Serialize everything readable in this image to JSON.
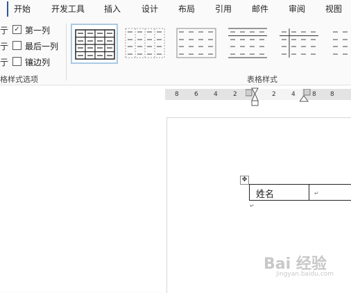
{
  "tabs": [
    "开始",
    "开发工具",
    "插入",
    "设计",
    "布局",
    "引用",
    "邮件",
    "审阅",
    "视图"
  ],
  "style_options": {
    "items": [
      {
        "cut_text": "亍",
        "label": "第一列",
        "checked": true
      },
      {
        "cut_text": "亍",
        "label": "最后一列",
        "checked": false
      },
      {
        "cut_text": "亍",
        "label": "镶边列",
        "checked": false
      }
    ],
    "group_label": "格样式选项"
  },
  "table_styles": {
    "group_label": "表格样式",
    "selected_index": 0
  },
  "ruler": {
    "numbers": [
      "8",
      "6",
      "4",
      "2",
      "2",
      "4",
      "8",
      "8"
    ]
  },
  "document": {
    "cell_text": "姓名",
    "cell_mark": "↵",
    "paragraph_mark": "↵"
  },
  "watermark": {
    "text": "Bai 经验",
    "subtext": "jingyan.baidu.com"
  },
  "colors": {
    "accent": "#2b579a",
    "selected_style_border": "#a9c9e3"
  }
}
